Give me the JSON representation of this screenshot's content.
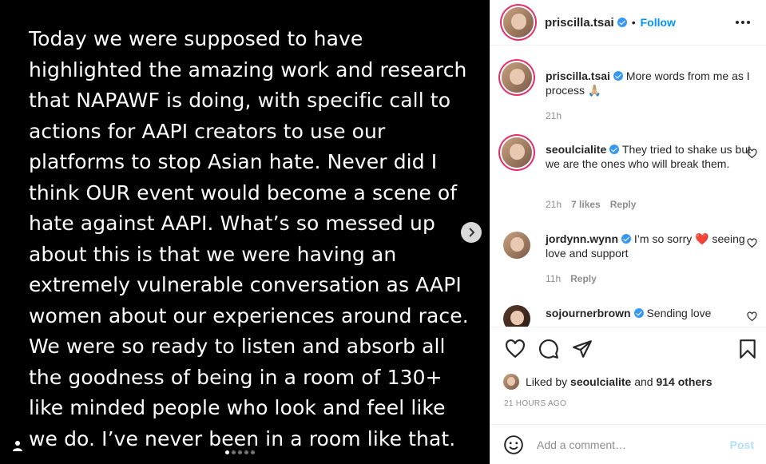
{
  "post": {
    "text": "Today we were supposed to have highlighted the amazing work and research that NAPAWF is doing, with specific call to actions for AAPI creators to use our platforms to stop Asian hate. Never did I think OUR event would become a scene of hate against AAPI. What’s so messed up about this is that we were having an extremely vulnerable conversation as AAPI women about our experiences around race. We were so ready to listen and absorb all the goodness of being in a room of 130+ like minded people who look and feel like we do. I’ve never been in a room like that.",
    "carousel": {
      "count": 5,
      "active_index": 0
    }
  },
  "header": {
    "username": "priscilla.tsai",
    "separator": "•",
    "follow_label": "Follow"
  },
  "comments": [
    {
      "username": "priscilla.tsai",
      "text": "More words from me as I process 🙏🏼",
      "time": "21h"
    },
    {
      "username": "seoulcialite",
      "text": "They tried to shake us but we are the ones who will break them.",
      "time": "21h",
      "likes": "7 likes",
      "reply": "Reply"
    },
    {
      "username": "jordynn.wynn",
      "text": "I’m so sorry ❤️ seeing love and support",
      "time": "11h",
      "reply": "Reply"
    },
    {
      "username": "sojournerbrown",
      "text": "Sending love"
    }
  ],
  "likes": {
    "prefix": "Liked by",
    "user": "seoulcialite",
    "middle": "and",
    "others": "914 others"
  },
  "timestamp": "21 HOURS AGO",
  "add_comment": {
    "placeholder": "Add a comment…",
    "post_label": "Post"
  },
  "colors": {
    "accent": "#0095f6",
    "verified": "#3897f0",
    "post_disabled": "#b2dffc",
    "heart_red": "#ed4956"
  },
  "icons": [
    "chevron-right-icon",
    "user-tag-icon",
    "more-options-icon",
    "heart-icon",
    "comment-icon",
    "share-icon",
    "bookmark-icon",
    "emoji-icon",
    "verified-icon"
  ]
}
